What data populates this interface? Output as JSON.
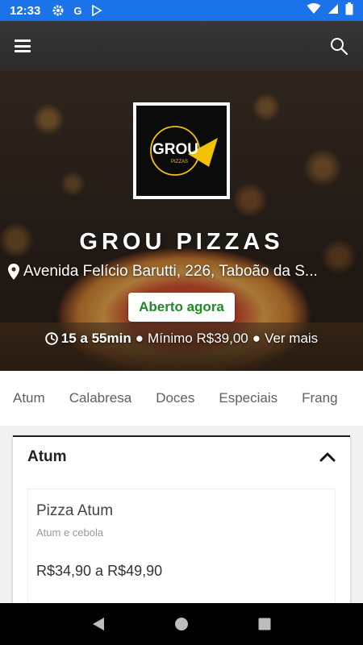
{
  "status_bar": {
    "time": "12:33",
    "left_icons": [
      "gear-icon",
      "google-icon",
      "play-store-icon"
    ],
    "right_icons": [
      "wifi-icon",
      "signal-icon",
      "battery-icon"
    ]
  },
  "app_bar": {
    "menu_icon": "hamburger-menu-icon",
    "search_icon": "search-icon"
  },
  "hero": {
    "logo": {
      "text": "GROU",
      "subtext": "PIZZAS"
    },
    "name": "GROU PIZZAS",
    "address": "Avenida Felício Barutti, 226, Taboão da S...",
    "status_badge": "Aberto agora",
    "delivery_time": "15 a 55min",
    "separator": "●",
    "minimum_order": "Mínimo R$39,00",
    "see_more": "Ver mais"
  },
  "categories": [
    "Atum",
    "Calabresa",
    "Doces",
    "Especiais",
    "Frang"
  ],
  "section": {
    "title": "Atum",
    "expanded_icon": "chevron-up-icon",
    "products": [
      {
        "name": "Pizza Atum",
        "description": "Atum e cebola",
        "price": "R$34,90 a R$49,90"
      }
    ]
  },
  "colors": {
    "status_bar": "#1a73e8",
    "app_bar": "#2f2f2f",
    "open_badge_text": "#1e8b24",
    "logo_accent": "#f2c200"
  },
  "nav_bar": [
    "back-icon",
    "home-icon",
    "recents-icon"
  ]
}
